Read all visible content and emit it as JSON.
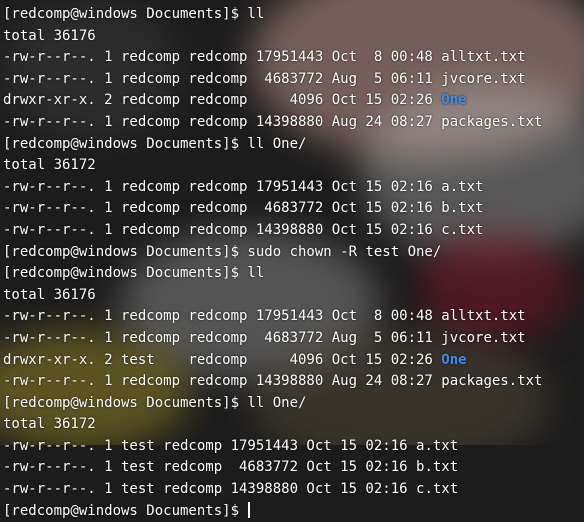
{
  "lines": [
    {
      "segments": [
        {
          "text": "[redcomp@windows Documents]$ ll"
        }
      ]
    },
    {
      "segments": [
        {
          "text": "total 36176"
        }
      ]
    },
    {
      "segments": [
        {
          "text": "-rw-r--r--. 1 redcomp redcomp 17951443 Oct  8 00:48 "
        },
        {
          "text": "alltxt.txt"
        }
      ]
    },
    {
      "segments": [
        {
          "text": "-rw-r--r--. 1 redcomp redcomp  4683772 Aug  5 06:11 "
        },
        {
          "text": "jvcore.txt"
        }
      ]
    },
    {
      "segments": [
        {
          "text": "drwxr-xr-x. 2 redcomp redcomp     4096 Oct 15 02:26 "
        },
        {
          "text": "One",
          "dir": true
        }
      ]
    },
    {
      "segments": [
        {
          "text": "-rw-r--r--. 1 redcomp redcomp 14398880 Aug 24 08:27 "
        },
        {
          "text": "packages.txt"
        }
      ]
    },
    {
      "segments": [
        {
          "text": "[redcomp@windows Documents]$ ll One/"
        }
      ]
    },
    {
      "segments": [
        {
          "text": "total 36172"
        }
      ]
    },
    {
      "segments": [
        {
          "text": "-rw-r--r--. 1 redcomp redcomp 17951443 Oct 15 02:16 "
        },
        {
          "text": "a.txt"
        }
      ]
    },
    {
      "segments": [
        {
          "text": "-rw-r--r--. 1 redcomp redcomp  4683772 Oct 15 02:16 "
        },
        {
          "text": "b.txt"
        }
      ]
    },
    {
      "segments": [
        {
          "text": "-rw-r--r--. 1 redcomp redcomp 14398880 Oct 15 02:16 "
        },
        {
          "text": "c.txt"
        }
      ]
    },
    {
      "segments": [
        {
          "text": "[redcomp@windows Documents]$ sudo chown -R test One/"
        }
      ]
    },
    {
      "segments": [
        {
          "text": "[redcomp@windows Documents]$ ll"
        }
      ]
    },
    {
      "segments": [
        {
          "text": "total 36176"
        }
      ]
    },
    {
      "segments": [
        {
          "text": "-rw-r--r--. 1 redcomp redcomp 17951443 Oct  8 00:48 "
        },
        {
          "text": "alltxt.txt"
        }
      ]
    },
    {
      "segments": [
        {
          "text": "-rw-r--r--. 1 redcomp redcomp  4683772 Aug  5 06:11 "
        },
        {
          "text": "jvcore.txt"
        }
      ]
    },
    {
      "segments": [
        {
          "text": "drwxr-xr-x. 2 test    redcomp     4096 Oct 15 02:26 "
        },
        {
          "text": "One",
          "dir": true
        }
      ]
    },
    {
      "segments": [
        {
          "text": "-rw-r--r--. 1 redcomp redcomp 14398880 Aug 24 08:27 "
        },
        {
          "text": "packages.txt"
        }
      ]
    },
    {
      "segments": [
        {
          "text": "[redcomp@windows Documents]$ ll One/"
        }
      ]
    },
    {
      "segments": [
        {
          "text": "total 36172"
        }
      ]
    },
    {
      "segments": [
        {
          "text": "-rw-r--r--. 1 test redcomp 17951443 Oct 15 02:16 "
        },
        {
          "text": "a.txt"
        }
      ]
    },
    {
      "segments": [
        {
          "text": "-rw-r--r--. 1 test redcomp  4683772 Oct 15 02:16 "
        },
        {
          "text": "b.txt"
        }
      ]
    },
    {
      "segments": [
        {
          "text": "-rw-r--r--. 1 test redcomp 14398880 Oct 15 02:16 "
        },
        {
          "text": "c.txt"
        }
      ]
    },
    {
      "segments": [
        {
          "text": "[redcomp@windows Documents]$ "
        }
      ],
      "cursor": true
    }
  ],
  "colors": {
    "text": "#ffffff",
    "directory": "#3a8ff0"
  }
}
